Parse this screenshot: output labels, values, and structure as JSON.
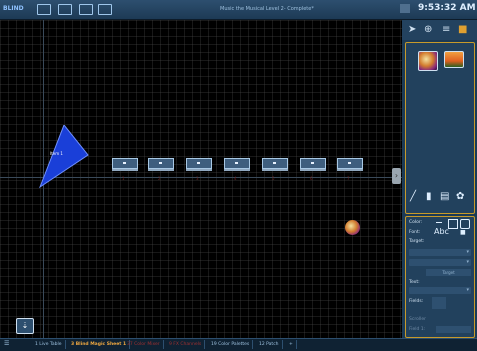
{
  "topbar": {
    "mode": "BLIND",
    "title": "Music the Musical Level 2- Complete*",
    "clock": "9:53:32 AM"
  },
  "canvas": {
    "blue_fixture_label": "Item 1",
    "fixture_numbers": [
      "1",
      "2",
      "3",
      "4",
      "5",
      "6",
      "7"
    ]
  },
  "props": {
    "color_label": "Color:",
    "font_label": "Font:",
    "font_sample": "Abc",
    "target_label": "Target:",
    "target_button": "Target",
    "text_label": "Text:",
    "fields_label": "Fields:",
    "scroller_label": "Scroller",
    "field_label": "Field 1:"
  },
  "tabs": [
    {
      "label": "1 Live Table",
      "state": "normal"
    },
    {
      "label": "3 Blind Magic Sheet 1",
      "state": "active"
    },
    {
      "label": "37 Color Mixer",
      "state": "dim"
    },
    {
      "label": "9 FX Channels",
      "state": "dim"
    },
    {
      "label": "19 Color Palettes",
      "state": "normal"
    },
    {
      "label": "12 Patch",
      "state": "normal"
    },
    {
      "label": "+",
      "state": "normal"
    }
  ],
  "colors": {
    "accent": "#c79a2a",
    "active_tab": "#f0a840",
    "panel": "#1c3a55",
    "blue_fixture": "#1a3fd8"
  }
}
